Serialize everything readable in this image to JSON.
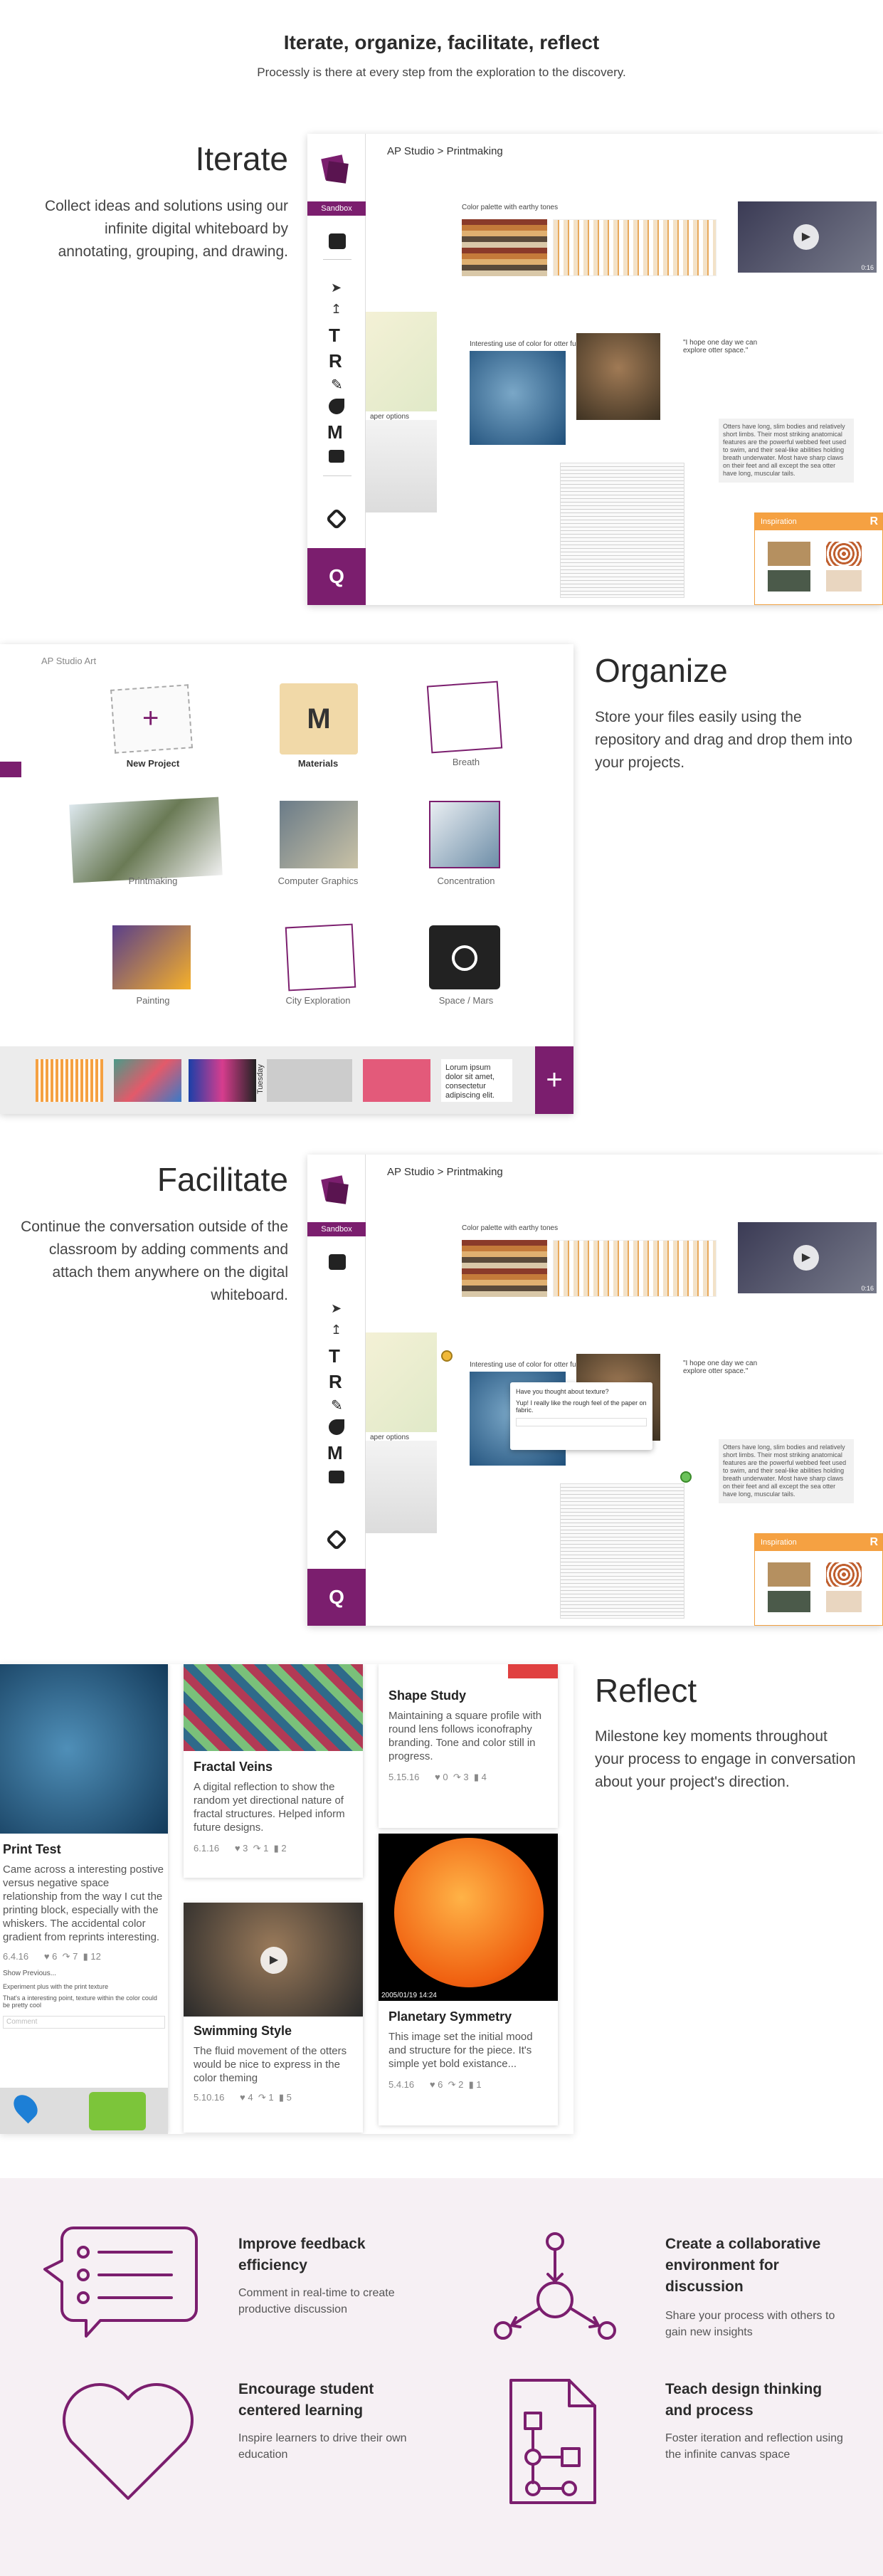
{
  "hero": {
    "title": "Iterate, organize, facilitate, reflect",
    "subtitle": "Processly is there at every step from the exploration to the discovery."
  },
  "iterate": {
    "title": "Iterate",
    "text": "Collect ideas and solutions using our infinite digital whiteboard by annotating, grouping, and drawing."
  },
  "organize": {
    "title": "Organize",
    "text": "Store your files easily using the repository and drag and drop them into your projects."
  },
  "facilitate": {
    "title": "Facilitate",
    "text": "Continue the conversation outside of the classroom by adding comments and attach them anywhere on the digital whiteboard."
  },
  "reflect": {
    "title": "Reflect",
    "text": "Milestone key moments throughout your process to engage in conversation about your project's direction."
  },
  "whiteboard": {
    "crumb_root": "AP Studio",
    "crumb_sep": ">",
    "crumb_page": "Printmaking",
    "sandbox": "Sandbox",
    "color_note": "Color palette with earthy tones",
    "color_use_note": "Interesting use of color for otter fur",
    "paper_note": "aper options",
    "quote": "\"I hope one day we can explore otter space.\"",
    "otter_note": "Otters have long, slim bodies and relatively short limbs. Their most striking anatomical features are the powerful webbed feet used to swim, and their seal-like abilities holding breath underwater. Most have sharp claws on their feet and all except the sea otter have long, muscular tails.",
    "inspiration": "Inspiration",
    "inspiration_badge": "R",
    "video_time": "0:16",
    "tools": [
      "T",
      "R",
      "M"
    ],
    "comment_1": "Have you thought about texture?",
    "comment_2": "Yup! I really like the rough feel of the paper on fabric.",
    "logo_letter": "Q"
  },
  "repository": {
    "header": "AP Studio Art",
    "folders": [
      {
        "label": "New Project"
      },
      {
        "label": "Materials"
      },
      {
        "label": "Breath"
      },
      {
        "label": "Printmaking"
      },
      {
        "label": "Computer Graphics"
      },
      {
        "label": "Concentration"
      },
      {
        "label": "Painting"
      },
      {
        "label": "City Exploration"
      },
      {
        "label": "Space / Mars"
      }
    ],
    "materials_letter": "M",
    "tray_text": "Lorum ipsum dolor sit amet, consectetur adipiscing elit.",
    "tray_day": "Tuesday",
    "plus": "+"
  },
  "milestones": {
    "cards": [
      {
        "title": "Print Test",
        "text": "Came across a interesting postive versus negative space relationship from the way I cut the printing block, especially with the whiskers. The accidental color gradient from reprints interesting.",
        "date": "6.4.16",
        "likes": "6",
        "shares": "7",
        "comments": "12"
      },
      {
        "title": "Fractal Veins",
        "text": "A digital reflection to show the random yet directional nature of fractal structures. Helped inform future designs.",
        "date": "6.1.16",
        "likes": "3",
        "shares": "1",
        "comments": "2"
      },
      {
        "title": "Shape Study",
        "text": "Maintaining a square profile with round lens follows iconofraphy branding. Tone and color still in progress.",
        "date": "5.15.16",
        "likes": "0",
        "shares": "3",
        "comments": "4"
      },
      {
        "title": "Swimming Style",
        "text": "The fluid movement of the otters would be nice to express in the color theming",
        "date": "5.10.16",
        "likes": "4",
        "shares": "1",
        "comments": "5"
      },
      {
        "title": "Planetary Symmetry",
        "text": "This image set the initial mood and structure for the piece. It's simple yet bold existance...",
        "date": "5.4.16",
        "likes": "6",
        "shares": "2",
        "comments": "1"
      }
    ],
    "show_previous": "Show Previous...",
    "comment_a": "Experiment plus with the print texture",
    "comment_b": "That's a interesting point, texture within the color could be pretty cool",
    "comment_placeholder": "Comment",
    "sun_stamp": "2005/01/19 14:24"
  },
  "features": [
    {
      "title": "Improve feedback efficiency",
      "text": "Comment in real-time to create productive discussion",
      "icon": "chat-bubble-list-icon"
    },
    {
      "title": "Create a collaborative environment for discussion",
      "text": "Share your process with others to gain new insights",
      "icon": "network-nodes-icon"
    },
    {
      "title": "Encourage student centered learning",
      "text": "Inspire learners to drive their own education",
      "icon": "heart-icon"
    },
    {
      "title": "Teach design thinking and process",
      "text": "Foster iteration and reflection using the infinite canvas space",
      "icon": "flowchart-document-icon"
    }
  ],
  "colors": {
    "brand": "#7b1e6e",
    "accent": "#f5a142",
    "band": "#f6f0f4"
  }
}
